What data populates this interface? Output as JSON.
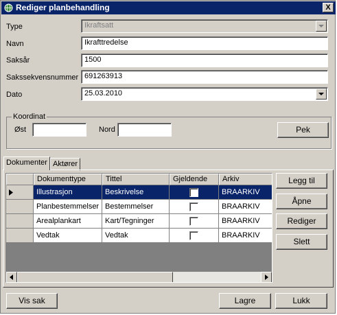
{
  "window": {
    "title": "Rediger planbehandling",
    "close_label": "X"
  },
  "form": {
    "type_label": "Type",
    "type_value": "Ikraftsatt",
    "navn_label": "Navn",
    "navn_value": "Ikrafttredelse",
    "saksar_label": "Saksår",
    "saksar_value": "1500",
    "sakssekvens_label": "Sakssekvensnummer",
    "sakssekvens_value": "691263913",
    "dato_label": "Dato",
    "dato_value": "25.03.2010"
  },
  "koordinat": {
    "title": "Koordinat",
    "ost_label": "Øst",
    "ost_value": "",
    "nord_label": "Nord",
    "nord_value": "",
    "pek_label": "Pek"
  },
  "tabs": [
    {
      "label": "Dokumenter",
      "active": true
    },
    {
      "label": "Aktører",
      "active": false
    }
  ],
  "grid": {
    "columns": [
      "Dokumenttype",
      "Tittel",
      "Gjeldende",
      "Arkiv"
    ],
    "rows": [
      {
        "dokumenttype": "Illustrasjon",
        "tittel": "Beskrivelse",
        "gjeldende": false,
        "arkiv": "BRAARKIV",
        "selected": true
      },
      {
        "dokumenttype": "Planbestemmelser",
        "tittel": "Bestemmelser",
        "gjeldende": false,
        "arkiv": "BRAARKIV",
        "selected": false
      },
      {
        "dokumenttype": "Arealplankart",
        "tittel": "Kart/Tegninger",
        "gjeldende": false,
        "arkiv": "BRAARKIV",
        "selected": false
      },
      {
        "dokumenttype": "Vedtak",
        "tittel": "Vedtak",
        "gjeldende": false,
        "arkiv": "BRAARKIV",
        "selected": false
      }
    ]
  },
  "side_buttons": {
    "legg_til": "Legg til",
    "apne": "Åpne",
    "rediger": "Rediger",
    "slett": "Slett"
  },
  "footer": {
    "vis_sak": "Vis sak",
    "lagre": "Lagre",
    "lukk": "Lukk"
  },
  "colors": {
    "titlebar": "#0a246a",
    "face": "#d4d0c8",
    "selection": "#0a246a"
  }
}
